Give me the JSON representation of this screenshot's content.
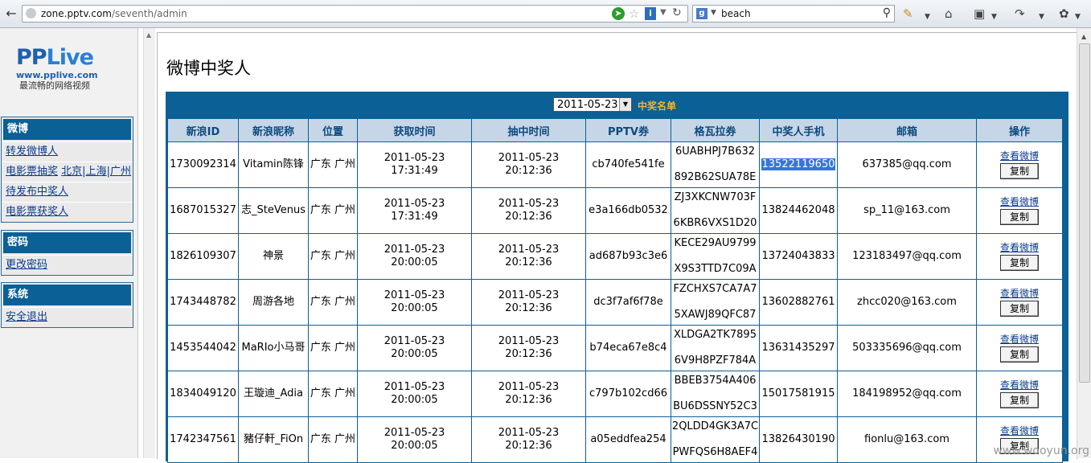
{
  "browser": {
    "url_host": "zone.pptv.com",
    "url_path": "/seventh/admin",
    "search_query": "beach"
  },
  "sidebar": {
    "logo_text_pp": "PP",
    "logo_text_live": "Live",
    "logo_site": "www.pplive.com",
    "logo_slogan": "最流畅的网络视频",
    "sections": [
      {
        "title": "微博",
        "items": [
          "转发微博人",
          "电影票抽奖",
          "待发布中奖人",
          "电影票获奖人"
        ],
        "cities": [
          "北京",
          "上海",
          "广州"
        ]
      },
      {
        "title": "密码",
        "items": [
          "更改密码"
        ]
      },
      {
        "title": "系统",
        "items": [
          "安全退出"
        ]
      }
    ]
  },
  "main": {
    "title": "微博中奖人",
    "date_selected": "2011-05-23",
    "list_label": "中奖名单",
    "columns": [
      "新浪ID",
      "新浪昵称",
      "位置",
      "获取时间",
      "抽中时间",
      "PPTV券",
      "格瓦拉券",
      "中奖人手机",
      "邮箱",
      "操作"
    ],
    "view_label": "查看微博",
    "copy_label": "复制",
    "rows": [
      {
        "id": "1730092314",
        "nick": "Vitamin陈锋",
        "loc": "广东 广州",
        "get_date": "2011-05-23",
        "get_time": "17:31:49",
        "draw_date": "2011-05-23",
        "draw_time": "20:12:36",
        "pptv": "cb740fe541fe",
        "gewa1": "6UABHPJ7B632",
        "gewa2": "892B62SUA78E",
        "phone": "13522119650",
        "email": "637385@qq.com"
      },
      {
        "id": "1687015327",
        "nick": "志_SteVenus",
        "loc": "广东 广州",
        "get_date": "2011-05-23",
        "get_time": "17:31:49",
        "draw_date": "2011-05-23",
        "draw_time": "20:12:36",
        "pptv": "e3a166db0532",
        "gewa1": "ZJ3XKCNW703F",
        "gewa2": "6KBR6VXS1D20",
        "phone": "13824462048",
        "email": "sp_11@163.com"
      },
      {
        "id": "1826109307",
        "nick": "神景",
        "loc": "广东 广州",
        "get_date": "2011-05-23",
        "get_time": "20:00:05",
        "draw_date": "2011-05-23",
        "draw_time": "20:12:36",
        "pptv": "ad687b93c3e6",
        "gewa1": "KECE29AU9799",
        "gewa2": "X9S3TTD7C09A",
        "phone": "13724043833",
        "email": "123183497@qq.com"
      },
      {
        "id": "1743448782",
        "nick": "周游各地",
        "loc": "广东 广州",
        "get_date": "2011-05-23",
        "get_time": "20:00:05",
        "draw_date": "2011-05-23",
        "draw_time": "20:12:36",
        "pptv": "dc3f7af6f78e",
        "gewa1": "FZCHXS7CA7A7",
        "gewa2": "5XAWJ89QFC87",
        "phone": "13602882761",
        "email": "zhcc020@163.com"
      },
      {
        "id": "1453544042",
        "nick": "MaRIo小马哥",
        "loc": "广东 广州",
        "get_date": "2011-05-23",
        "get_time": "20:00:05",
        "draw_date": "2011-05-23",
        "draw_time": "20:12:36",
        "pptv": "b74eca67e8c4",
        "gewa1": "XLDGA2TK7895",
        "gewa2": "6V9H8PZF784A",
        "phone": "13631435297",
        "email": "503335696@qq.com"
      },
      {
        "id": "1834049120",
        "nick": "王璇迪_Adia",
        "loc": "广东 广州",
        "get_date": "2011-05-23",
        "get_time": "20:00:05",
        "draw_date": "2011-05-23",
        "draw_time": "20:12:36",
        "pptv": "c797b102cd66",
        "gewa1": "BBEB3754A406",
        "gewa2": "BU6DSSNY52C3",
        "phone": "15017581915",
        "email": "184198952@qq.com"
      },
      {
        "id": "1742347561",
        "nick": "豬仔軒_FiOn",
        "loc": "广东 广州",
        "get_date": "2011-05-23",
        "get_time": "20:00:05",
        "draw_date": "2011-05-23",
        "draw_time": "20:12:36",
        "pptv": "a05eddfea254",
        "gewa1": "2QLDD4GK3A7C",
        "gewa2": "PWFQS6H8AEF4",
        "phone": "13826430190",
        "email": "fionlu@163.com"
      }
    ]
  },
  "watermark": "www.wooyun.org"
}
